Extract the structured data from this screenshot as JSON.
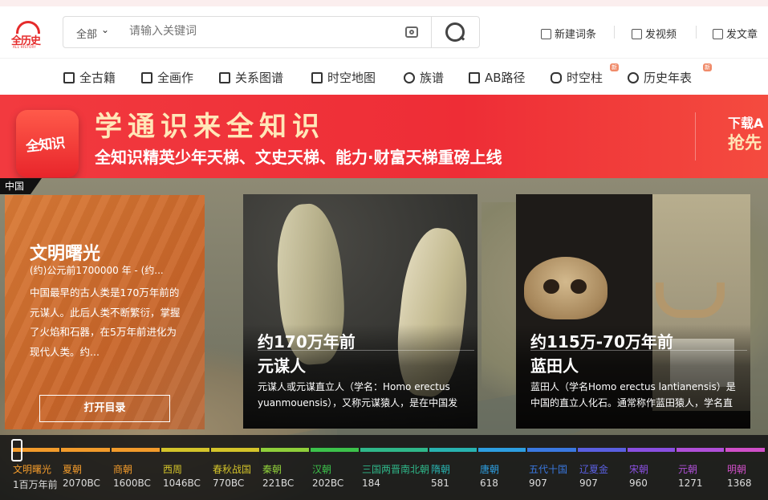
{
  "header": {
    "logo_text": "全历史",
    "logo_sub": "ALL HISTORY",
    "search_scope": "全部",
    "search_placeholder": "请输入关键词",
    "links": [
      "新建词条",
      "发视频",
      "发文章"
    ]
  },
  "nav": {
    "items": [
      {
        "label": "全古籍",
        "icon": "book-icon"
      },
      {
        "label": "全画作",
        "icon": "painting-icon"
      },
      {
        "label": "关系图谱",
        "icon": "graph-icon"
      },
      {
        "label": "时空地图",
        "icon": "map-icon"
      },
      {
        "label": "族谱",
        "icon": "person-icon"
      },
      {
        "label": "AB路径",
        "icon": "path-icon"
      },
      {
        "label": "时空柱",
        "icon": "cylinder-icon",
        "badge": "新"
      },
      {
        "label": "历史年表",
        "icon": "clock-icon",
        "badge": "新"
      }
    ]
  },
  "banner": {
    "app_icon_text": "全知识",
    "title": "学通识来全知识",
    "subtitle": "全知识精英少年天梯、文史天梯、能力·财富天梯重磅上线",
    "cta_line1": "下载A",
    "cta_line2": "抢先"
  },
  "region_tag": "中国",
  "intro": {
    "era": "文明曙光",
    "dates": "(约)公元前1700000 年 - (约...",
    "desc": "中国最早的古人类是170万年前的元谋人。此后人类不断繁衍，掌握了火焰和石器，在5万年前进化为现代人类。约...",
    "open_label": "打开目录"
  },
  "cards": [
    {
      "time": "约170万年前",
      "name": "元谋人",
      "desc": "元谋人或元谋直立人（学名：Homo erectus yuanmouensis），又称元谋猿人，是在中国发"
    },
    {
      "time": "约115万-70万年前",
      "name": "蓝田人",
      "desc": "蓝田人（学名Homo erectus lantianensis）是中国的直立人化石。通常称作蓝田猿人，学名直"
    }
  ],
  "timeline": {
    "periods": [
      {
        "name": "文明曙光",
        "date": "1百万年前",
        "color": "#f29b2b"
      },
      {
        "name": "夏朝",
        "date": "2070BC",
        "color": "#f29b2b"
      },
      {
        "name": "商朝",
        "date": "1600BC",
        "color": "#f29b2b"
      },
      {
        "name": "西周",
        "date": "1046BC",
        "color": "#d4c42a"
      },
      {
        "name": "春秋战国",
        "date": "770BC",
        "color": "#d4c42a"
      },
      {
        "name": "秦朝",
        "date": "221BC",
        "color": "#8fcf3a"
      },
      {
        "name": "汉朝",
        "date": "202BC",
        "color": "#3cc24b"
      },
      {
        "name": "三国两晋南北朝",
        "date": "184",
        "color": "#2fb88a"
      },
      {
        "name": "隋朝",
        "date": "581",
        "color": "#28b3b0"
      },
      {
        "name": "唐朝",
        "date": "618",
        "color": "#2d9ee0"
      },
      {
        "name": "五代十国",
        "date": "907",
        "color": "#3a78e0"
      },
      {
        "name": "辽夏金",
        "date": "907",
        "color": "#5a5fe0"
      },
      {
        "name": "宋朝",
        "date": "960",
        "color": "#8a4fe0"
      },
      {
        "name": "元朝",
        "date": "1271",
        "color": "#b04fd8"
      },
      {
        "name": "明朝",
        "date": "1368",
        "color": "#d04fc8"
      }
    ]
  }
}
